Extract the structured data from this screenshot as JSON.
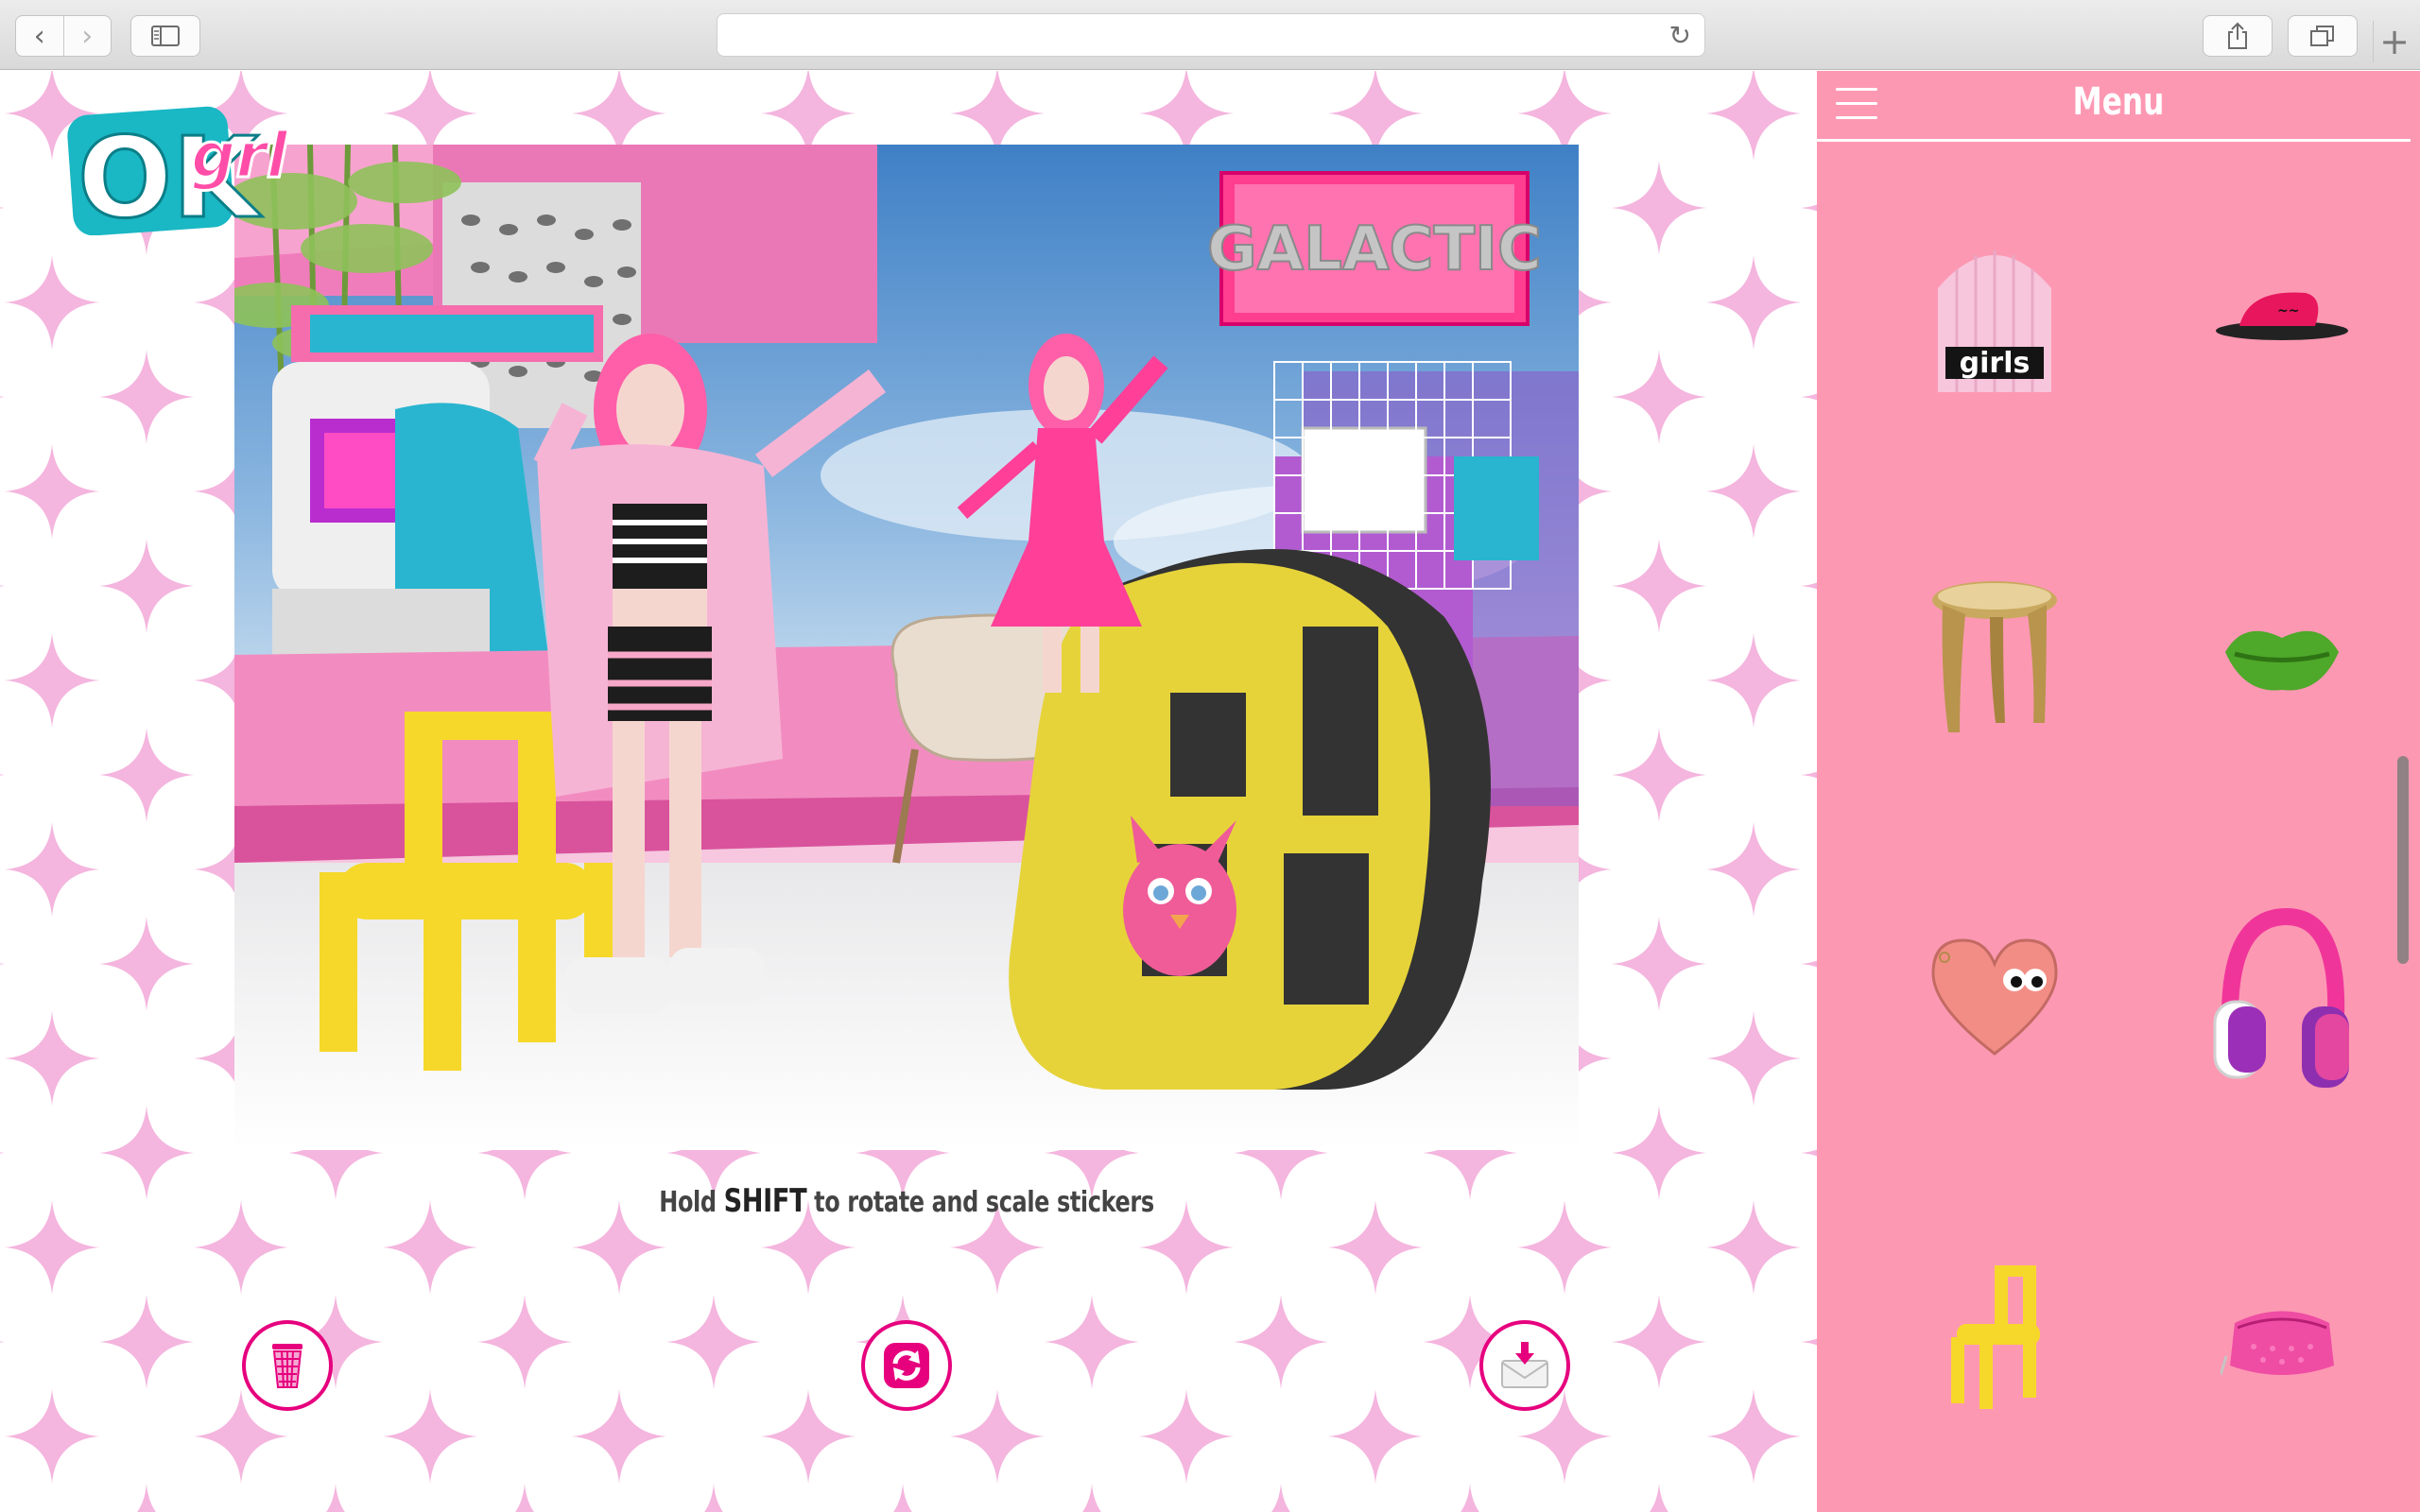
{
  "browser": {
    "back_symbol": "‹",
    "forward_symbol": "›",
    "reload_symbol": "↻",
    "newtab_symbol": "+",
    "address": ""
  },
  "site": {
    "logo_main": "OK",
    "logo_sub": "grl",
    "sign_text": "GALACTIC",
    "hint_prefix": "Hold ",
    "hint_key": "SHIFT",
    "hint_suffix": " to rotate and scale stickers"
  },
  "panel": {
    "title": "Menu",
    "stickers": [
      {
        "name": "girls-beanie",
        "text": "girls"
      },
      {
        "name": "slide-sandal",
        "text": ""
      },
      {
        "name": "gold-stool",
        "text": ""
      },
      {
        "name": "green-lips",
        "text": ""
      },
      {
        "name": "heart-purse",
        "text": ""
      },
      {
        "name": "headphones",
        "text": ""
      },
      {
        "name": "yellow-chair",
        "text": ""
      },
      {
        "name": "pink-pouch",
        "text": ""
      }
    ]
  },
  "colors": {
    "accent": "#e6007e",
    "panel": "#fd98b3",
    "scene_pink": "#f28cc0",
    "logo_teal": "#1ab7c4"
  }
}
